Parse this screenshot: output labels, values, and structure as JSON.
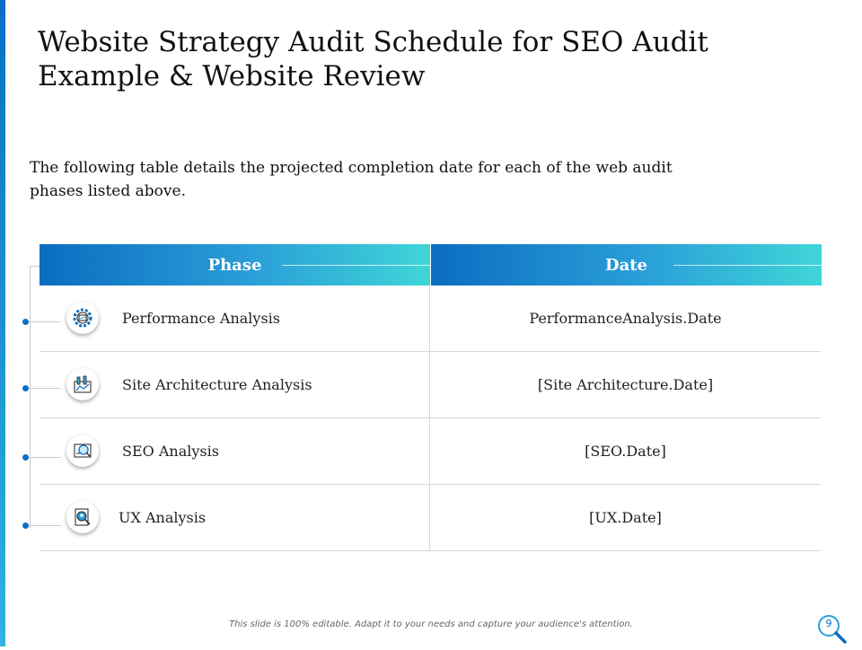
{
  "slide": {
    "title": "Website Strategy Audit Schedule for SEO Audit Example & Website Review",
    "description": "The following table details the projected completion date for each of the web audit phases listed above.",
    "footer": "This slide is 100% editable. Adapt it to your needs and capture your audience's attention.",
    "page_number": "9"
  },
  "table": {
    "headers": {
      "phase": "Phase",
      "date": "Date"
    },
    "rows": [
      {
        "phase": "Performance Analysis",
        "date": "PerformanceAnalysis.Date",
        "icon": "gear-dashboard-icon"
      },
      {
        "phase": "Site Architecture Analysis",
        "date": "[Site Architecture.Date]",
        "icon": "building-blueprint-icon"
      },
      {
        "phase": "SEO Analysis",
        "date": "[SEO.Date]",
        "icon": "seo-magnifier-icon"
      },
      {
        "phase": "UX Analysis",
        "date": "[UX.Date]",
        "icon": "user-search-icon"
      }
    ]
  },
  "colors": {
    "accent_dark": "#0b6dc1",
    "accent_light": "#3fd6d8",
    "dot": "#0a6fc4"
  }
}
